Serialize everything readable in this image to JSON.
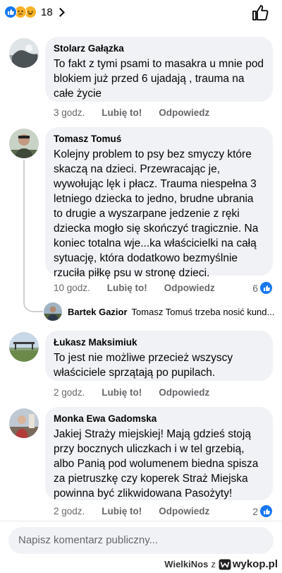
{
  "reactions": {
    "count": "18",
    "icons": [
      "like-icon",
      "sad-icon",
      "haha-icon"
    ]
  },
  "comments": [
    {
      "author": "Stolarz Gałązka",
      "text": "To fakt z tymi psami to masakra u mnie pod blokiem już przed 6 ujadają , trauma na całe życie",
      "time": "3 godz.",
      "like_label": "Lubię to!",
      "reply_label": "Odpowiedz"
    },
    {
      "author": "Tomasz Tomuś",
      "text": "Kolejny problem to psy bez smyczy które skaczą na dzieci. Przewracając je, wywołując lęk i płacz. Trauma niespełna 3 letniego dziecka to jedno, brudne ubrania to drugie a wyszarpane jedzenie z ręki dziecka mogło się skończyć tragicznie. Na koniec totalna wje...ka właścicielki na całą sytuację, która dodatkowo bezmyślnie rzuciła piłkę psu w stronę dzieci.",
      "time": "10 godz.",
      "like_label": "Lubię to!",
      "reply_label": "Odpowiedz",
      "reaction_count": "6"
    },
    {
      "author": "Łukasz Maksimiuk",
      "text": "To jest nie możliwe przecież wszyscy właściciele sprzątają po pupilach.",
      "time": "2 godz.",
      "like_label": "Lubię to!",
      "reply_label": "Odpowiedz"
    },
    {
      "author": "Monka Ewa Gadomska",
      "text": "Jakiej Straży miejskiej! Mają gdzieś stoją przy bocznych uliczkach i w tel grzebią, albo Panią pod wolumenem biedna spisza za pietruszkę czy koperek Straż Miejska powinna być zlikwidowana Pasożyty!",
      "time": "2 godz.",
      "like_label": "Lubię to!",
      "reply_label": "Odpowiedz",
      "reaction_count": "2"
    }
  ],
  "reply": {
    "author": "Bartek Gazior",
    "text": "Tomasz Tomuś trzeba nosić kund..."
  },
  "composer": {
    "placeholder": "Napisz komentarz publiczny..."
  },
  "watermark": {
    "user": "WielkiNos",
    "z": "z",
    "site": "wykop.pl"
  },
  "colors": {
    "bubble": "#f0f2f5",
    "meta": "#65676b",
    "accent": "#1877f2"
  }
}
